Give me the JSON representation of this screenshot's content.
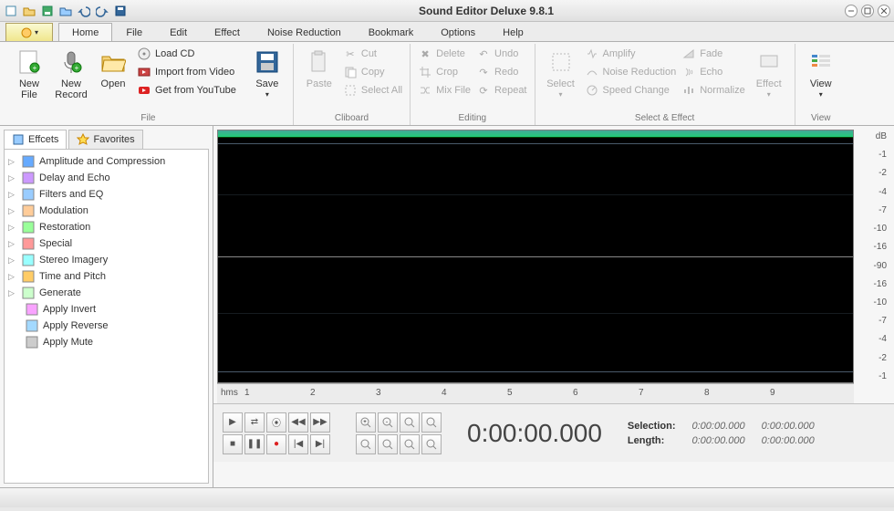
{
  "title": "Sound Editor Deluxe 9.8.1",
  "menu": {
    "tabs": [
      "Home",
      "File",
      "Edit",
      "Effect",
      "Noise Reduction",
      "Bookmark",
      "Options",
      "Help"
    ],
    "active": 0
  },
  "ribbon": {
    "file": {
      "label": "File",
      "newfile": "New\nFile",
      "newrecord": "New\nRecord",
      "open": "Open",
      "loadcd": "Load CD",
      "importvideo": "Import from Video",
      "youtube": "Get from YouTube",
      "save": "Save"
    },
    "clipboard": {
      "label": "Cliboard",
      "paste": "Paste",
      "cut": "Cut",
      "copy": "Copy",
      "selectall": "Select All"
    },
    "editing": {
      "label": "Editing",
      "delete": "Delete",
      "crop": "Crop",
      "mixfile": "Mix File",
      "undo": "Undo",
      "redo": "Redo",
      "repeat": "Repeat"
    },
    "selecteffect": {
      "label": "Select & Effect",
      "select": "Select",
      "amplify": "Amplify",
      "noise": "Noise Reduction",
      "speed": "Speed Change",
      "fade": "Fade",
      "echo": "Echo",
      "normalize": "Normalize",
      "effect": "Effect"
    },
    "view": {
      "label": "View",
      "view": "View"
    }
  },
  "sidepanel": {
    "tabs": {
      "effects": "Effcets",
      "favorites": "Favorites"
    },
    "tree": [
      {
        "label": "Amplitude and Compression",
        "expandable": true
      },
      {
        "label": "Delay and Echo",
        "expandable": true
      },
      {
        "label": "Filters and EQ",
        "expandable": true
      },
      {
        "label": "Modulation",
        "expandable": true
      },
      {
        "label": "Restoration",
        "expandable": true
      },
      {
        "label": "Special",
        "expandable": true
      },
      {
        "label": "Stereo Imagery",
        "expandable": true
      },
      {
        "label": "Time and Pitch",
        "expandable": true
      },
      {
        "label": "Generate",
        "expandable": true
      },
      {
        "label": "Apply Invert",
        "expandable": false
      },
      {
        "label": "Apply Reverse",
        "expandable": false
      },
      {
        "label": "Apply Mute",
        "expandable": false
      }
    ]
  },
  "waveform": {
    "db_label": "dB",
    "db_ticks": [
      "-1",
      "-2",
      "-4",
      "-7",
      "-10",
      "-16",
      "-90",
      "-16",
      "-10",
      "-7",
      "-4",
      "-2",
      "-1"
    ],
    "ruler_unit": "hms",
    "ruler_ticks": [
      "1",
      "2",
      "3",
      "4",
      "5",
      "6",
      "7",
      "8",
      "9"
    ]
  },
  "transport": {
    "timecode": "0:00:00.000",
    "selection_label": "Selection:",
    "length_label": "Length:",
    "zero": "0:00:00.000"
  }
}
